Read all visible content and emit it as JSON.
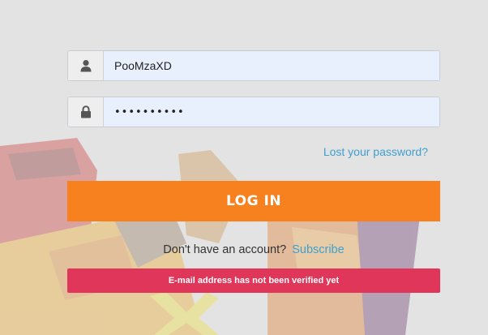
{
  "login": {
    "username": {
      "value": "PooMzaXD",
      "icon": "user-icon"
    },
    "password": {
      "value": "••••••••••",
      "icon": "lock-icon"
    },
    "forgot_password_label": "Lost your password?",
    "login_button_label": "LOG IN",
    "signup_prompt": "Don't have an account?",
    "signup_link_label": "Subscribe",
    "error_message": "E-mail address has not been verified yet"
  },
  "colors": {
    "background": "#e3e3e3",
    "input_bg": "#e8f0fe",
    "link": "#3f9fcf",
    "primary_button": "#f7801f",
    "error": "#e0365a"
  }
}
